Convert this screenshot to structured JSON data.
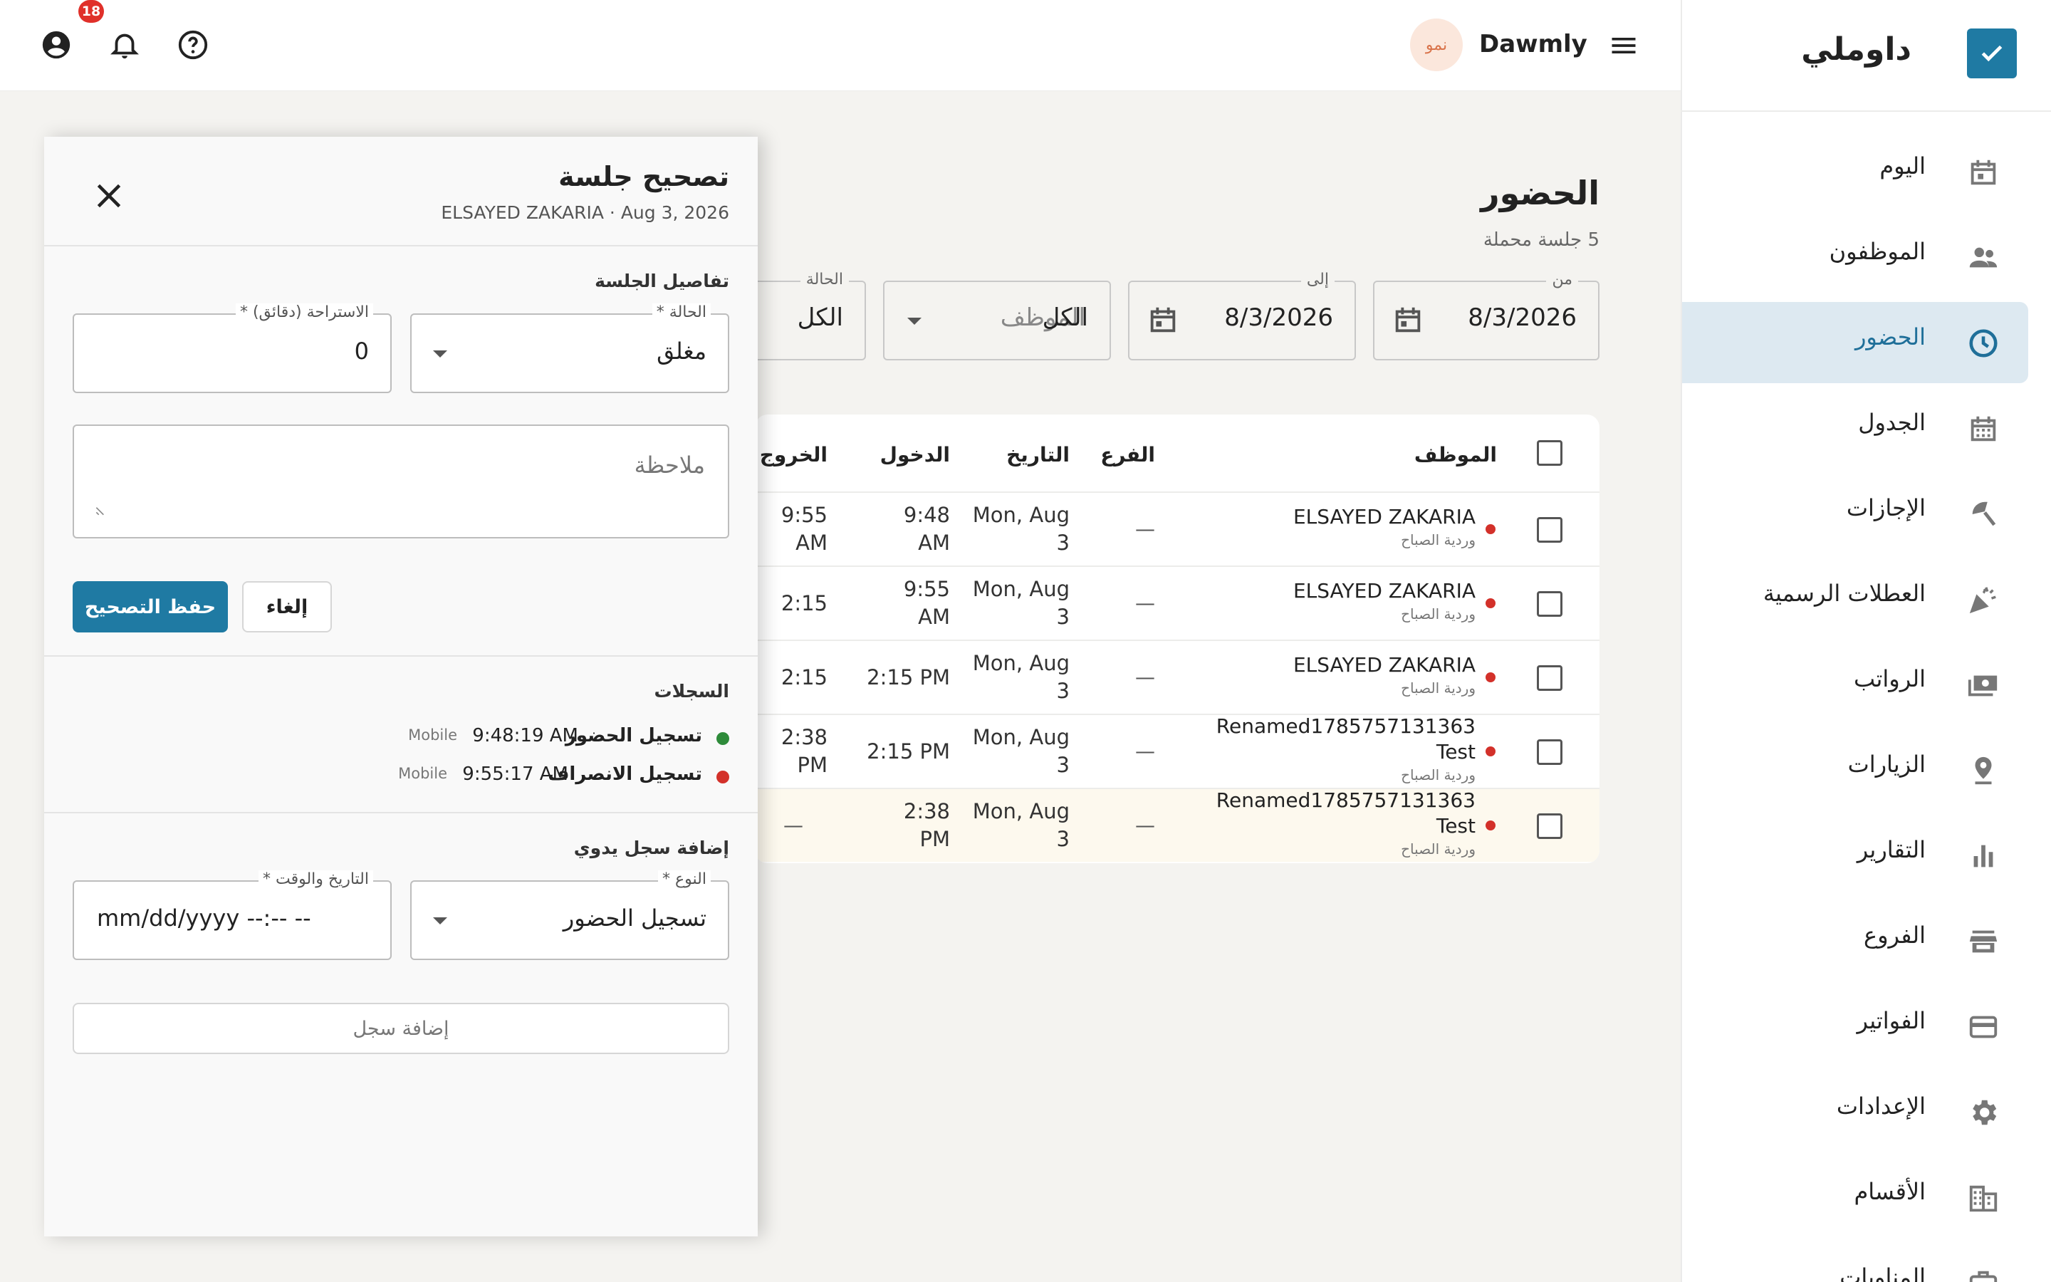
{
  "brand": {
    "name": "داوملي"
  },
  "appbar": {
    "app_name": "Dawmly",
    "avatar_text": "نمو",
    "notifications_count": "18"
  },
  "sidebar": {
    "items": [
      {
        "label": "اليوم",
        "icon": "calendar-today-icon"
      },
      {
        "label": "الموظفون",
        "icon": "people-icon"
      },
      {
        "label": "الحضور",
        "icon": "clock-icon",
        "active": true
      },
      {
        "label": "الجدول",
        "icon": "calendar-month-icon"
      },
      {
        "label": "الإجازات",
        "icon": "beach-umbrella-icon"
      },
      {
        "label": "العطلات الرسمية",
        "icon": "celebration-icon"
      },
      {
        "label": "الرواتب",
        "icon": "payments-icon"
      },
      {
        "label": "الزيارات",
        "icon": "location-pin-icon"
      },
      {
        "label": "التقارير",
        "icon": "bar-chart-icon"
      },
      {
        "label": "الفروع",
        "icon": "store-icon"
      },
      {
        "label": "الفواتير",
        "icon": "credit-card-icon"
      },
      {
        "label": "الإعدادات",
        "icon": "gear-icon"
      },
      {
        "label": "الأقسام",
        "icon": "building-icon"
      },
      {
        "label": "المناوبات",
        "icon": "briefcase-icon"
      }
    ]
  },
  "page": {
    "title": "الحضور",
    "subtitle": "5 جلسة محملة"
  },
  "filters": {
    "from": {
      "label": "من",
      "value": "8/3/2026"
    },
    "to": {
      "label": "إلى",
      "value": "8/3/2026"
    },
    "employee": {
      "placeholder": "الموظف",
      "value": "الكل"
    },
    "status": {
      "label": "الحالة",
      "value": "الكل"
    }
  },
  "table": {
    "headers": {
      "employee": "الموظف",
      "branch": "الفرع",
      "date": "التاريخ",
      "in": "الدخول",
      "out": "الخروج"
    },
    "rows": [
      {
        "name": "ELSAYED ZAKARIA",
        "shift": "وردية الصباح",
        "branch": "—",
        "date": "Mon, Aug 3",
        "in": "9:48 AM",
        "out": "9:55 AM"
      },
      {
        "name": "ELSAYED ZAKARIA",
        "shift": "وردية الصباح",
        "branch": "—",
        "date": "Mon, Aug 3",
        "in": "9:55 AM",
        "out": "2:15"
      },
      {
        "name": "ELSAYED ZAKARIA",
        "shift": "وردية الصباح",
        "branch": "—",
        "date": "Mon, Aug 3",
        "in": "2:15 PM",
        "out": "2:15"
      },
      {
        "name": "Renamed1785757131363 Test",
        "shift": "وردية الصباح",
        "branch": "—",
        "date": "Mon, Aug 3",
        "in": "2:15 PM",
        "out": "2:38 PM"
      },
      {
        "name": "Renamed1785757131363 Test",
        "shift": "وردية الصباح",
        "branch": "—",
        "date": "Mon, Aug 3",
        "in": "2:38 PM",
        "out": "—"
      }
    ]
  },
  "panel": {
    "title": "تصحيح جلسة",
    "subtitle": "ELSAYED ZAKARIA · Aug 3, 2026",
    "details_section": "تفاصيل الجلسة",
    "status": {
      "label": "الحالة *",
      "value": "مغلق"
    },
    "break": {
      "label": "الاستراحة (دقائق) *",
      "value": "0"
    },
    "note_placeholder": "ملاحظة",
    "save_label": "حفظ التصحيح",
    "cancel_label": "إلغاء",
    "logs_section": "السجلات",
    "logs": [
      {
        "type": "تسجيل الحضور",
        "time": "9:48:19 AM",
        "source": "Mobile",
        "color": "#2e8b3a"
      },
      {
        "type": "تسجيل الانصراف",
        "time": "9:55:17 AM",
        "source": "Mobile",
        "color": "#d3312a"
      }
    ],
    "manual_section": "إضافة سجل يدوي",
    "type_field": {
      "label": "النوع *",
      "value": "تسجيل الحضور"
    },
    "datetime_field": {
      "label": "التاريخ والوقت *",
      "value": "mm/dd/yyyy --:-- --"
    },
    "add_label": "إضافة سجل"
  }
}
